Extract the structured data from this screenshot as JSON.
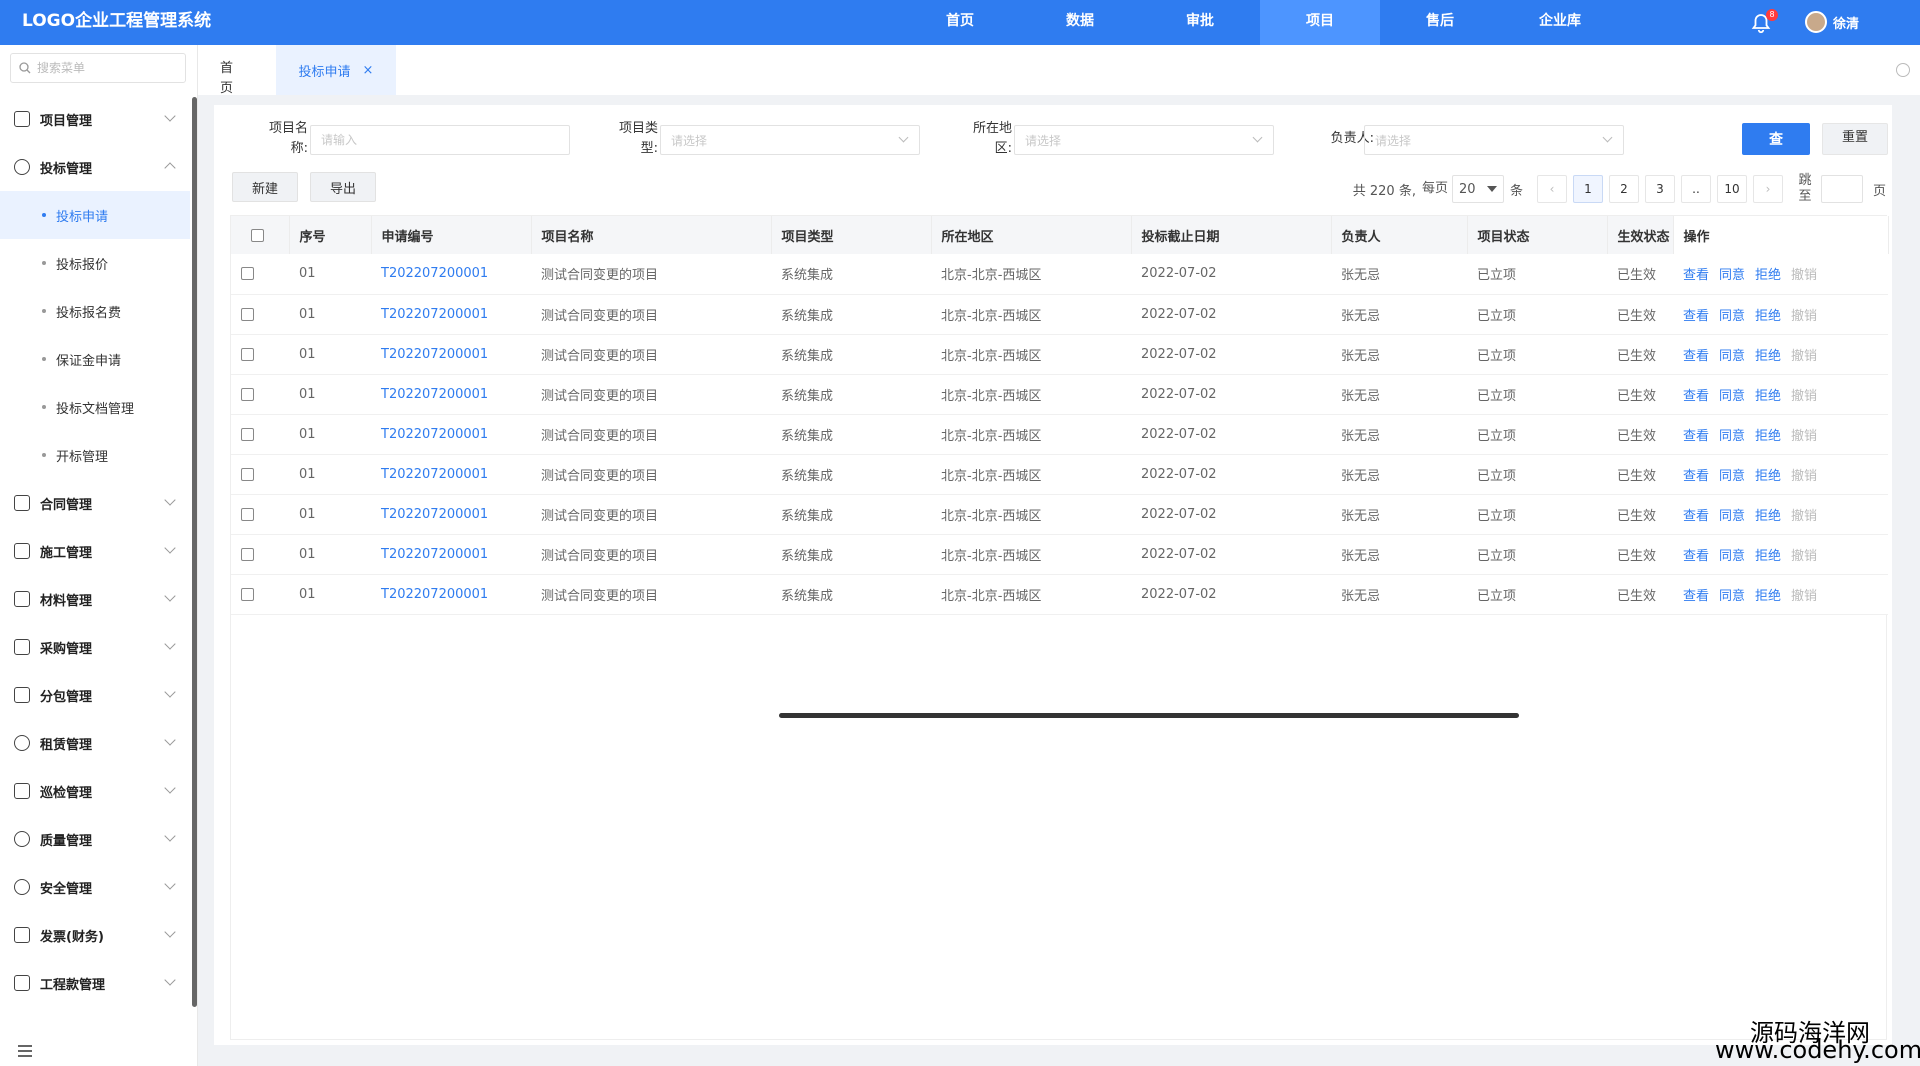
{
  "header": {
    "logo": "LOGO企业工程管理系统",
    "nav": [
      "首页",
      "数据",
      "审批",
      "项目",
      "售后",
      "企业库"
    ],
    "active_nav": 3,
    "notification_count": "8",
    "user_name": "徐清"
  },
  "sidebar": {
    "search_placeholder": "搜索菜单",
    "top_items": [
      {
        "label": "项目管理"
      },
      {
        "label": "投标管理"
      }
    ],
    "sub_items": [
      "投标申请",
      "投标报价",
      "投标报名费",
      "保证金申请",
      "投标文档管理",
      "开标管理"
    ],
    "active_sub": 0,
    "bottom_items": [
      {
        "label": "合同管理"
      },
      {
        "label": "施工管理"
      },
      {
        "label": "材料管理"
      },
      {
        "label": "采购管理"
      },
      {
        "label": "分包管理"
      },
      {
        "label": "租赁管理"
      },
      {
        "label": "巡检管理"
      },
      {
        "label": "质量管理"
      },
      {
        "label": "安全管理"
      },
      {
        "label": "发票(财务)"
      },
      {
        "label": "工程款管理"
      }
    ]
  },
  "tabs": {
    "home": "首页",
    "active": "投标申请",
    "close": "×"
  },
  "filters": {
    "project_name_label": "项目名称:",
    "project_name_placeholder": "请输入",
    "project_type_label": "项目类型:",
    "project_type_placeholder": "请选择",
    "region_label": "所在地区:",
    "region_placeholder": "请选择",
    "owner_label": "负责人:",
    "owner_placeholder": "请选择",
    "query": "查",
    "reset": "重置"
  },
  "toolbar": {
    "new": "新建",
    "export": "导出"
  },
  "pagination": {
    "total": "共 220 条,",
    "per_page": "每页",
    "page_size": "20",
    "unit": "条",
    "pages": [
      "1",
      "2",
      "3",
      "..",
      "10"
    ],
    "prev": "‹",
    "next": "›",
    "goto": "跳至",
    "page_suffix": "页"
  },
  "table": {
    "columns": [
      "序号",
      "申请编号",
      "项目名称",
      "项目类型",
      "所在地区",
      "投标截止日期",
      "负责人",
      "项目状态",
      "生效状态",
      "操作"
    ],
    "rows": [
      {
        "no": "01",
        "code": "T202207200001",
        "name": "测试合同变更的项目",
        "type": "系统集成",
        "region": "北京-北京-西城区",
        "deadline": "2022-07-02",
        "owner": "张无忌",
        "status": "已立项",
        "effect": "已生效"
      },
      {
        "no": "01",
        "code": "T202207200001",
        "name": "测试合同变更的项目",
        "type": "系统集成",
        "region": "北京-北京-西城区",
        "deadline": "2022-07-02",
        "owner": "张无忌",
        "status": "已立项",
        "effect": "已生效"
      },
      {
        "no": "01",
        "code": "T202207200001",
        "name": "测试合同变更的项目",
        "type": "系统集成",
        "region": "北京-北京-西城区",
        "deadline": "2022-07-02",
        "owner": "张无忌",
        "status": "已立项",
        "effect": "已生效"
      },
      {
        "no": "01",
        "code": "T202207200001",
        "name": "测试合同变更的项目",
        "type": "系统集成",
        "region": "北京-北京-西城区",
        "deadline": "2022-07-02",
        "owner": "张无忌",
        "status": "已立项",
        "effect": "已生效"
      },
      {
        "no": "01",
        "code": "T202207200001",
        "name": "测试合同变更的项目",
        "type": "系统集成",
        "region": "北京-北京-西城区",
        "deadline": "2022-07-02",
        "owner": "张无忌",
        "status": "已立项",
        "effect": "已生效"
      },
      {
        "no": "01",
        "code": "T202207200001",
        "name": "测试合同变更的项目",
        "type": "系统集成",
        "region": "北京-北京-西城区",
        "deadline": "2022-07-02",
        "owner": "张无忌",
        "status": "已立项",
        "effect": "已生效"
      },
      {
        "no": "01",
        "code": "T202207200001",
        "name": "测试合同变更的项目",
        "type": "系统集成",
        "region": "北京-北京-西城区",
        "deadline": "2022-07-02",
        "owner": "张无忌",
        "status": "已立项",
        "effect": "已生效"
      },
      {
        "no": "01",
        "code": "T202207200001",
        "name": "测试合同变更的项目",
        "type": "系统集成",
        "region": "北京-北京-西城区",
        "deadline": "2022-07-02",
        "owner": "张无忌",
        "status": "已立项",
        "effect": "已生效"
      },
      {
        "no": "01",
        "code": "T202207200001",
        "name": "测试合同变更的项目",
        "type": "系统集成",
        "region": "北京-北京-西城区",
        "deadline": "2022-07-02",
        "owner": "张无忌",
        "status": "已立项",
        "effect": "已生效"
      }
    ],
    "actions": [
      "查看",
      "同意",
      "拒绝",
      "撤销"
    ]
  },
  "watermark": {
    "line1": "源码海洋网",
    "line2": "www.codehy.com"
  },
  "colors": {
    "primary": "#2f7cf0",
    "header_bg": "#2f7cf0",
    "active_tab_bg": "#eaf2ff",
    "disabled": "#bbbbbb"
  }
}
